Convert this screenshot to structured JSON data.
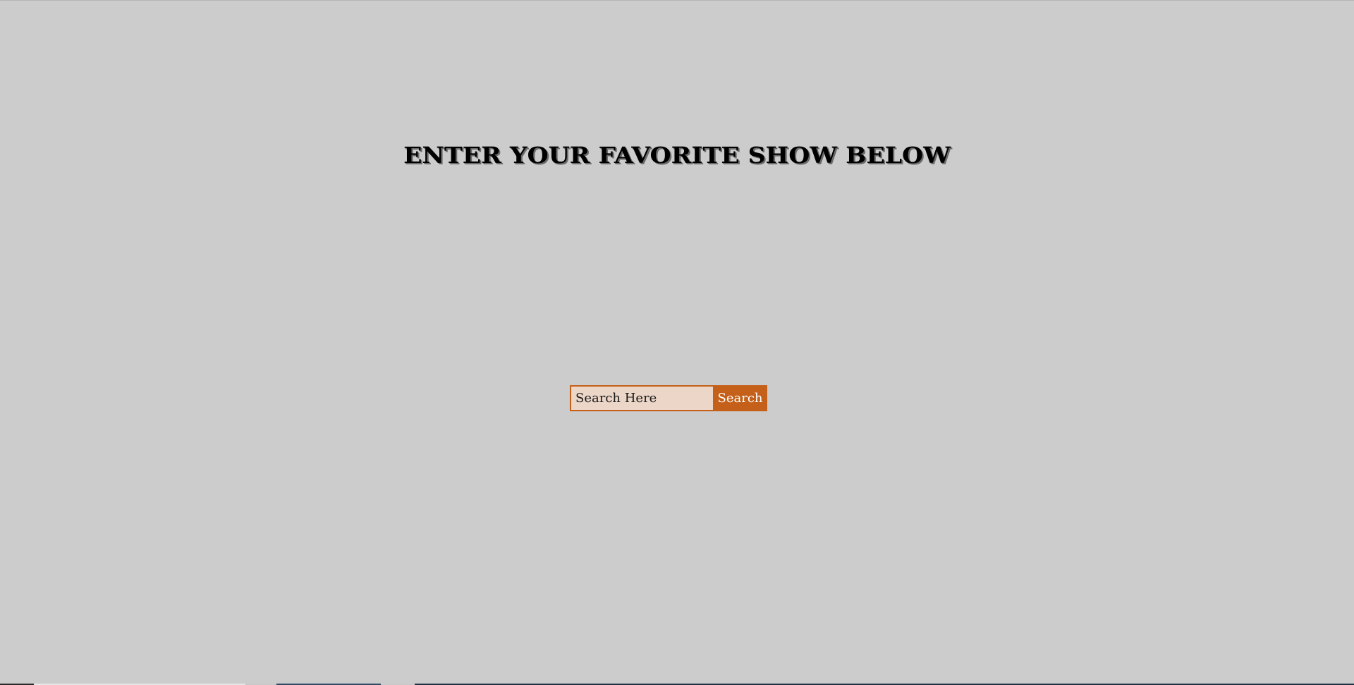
{
  "page": {
    "title": "ENTER YOUR FAVORITE SHOW BELOW",
    "background_color": "#cccccc"
  },
  "search": {
    "placeholder": "Search Here",
    "value": "",
    "button_label": "Search",
    "accent_color": "#c4601a",
    "input_background": "#ecd6c7"
  }
}
